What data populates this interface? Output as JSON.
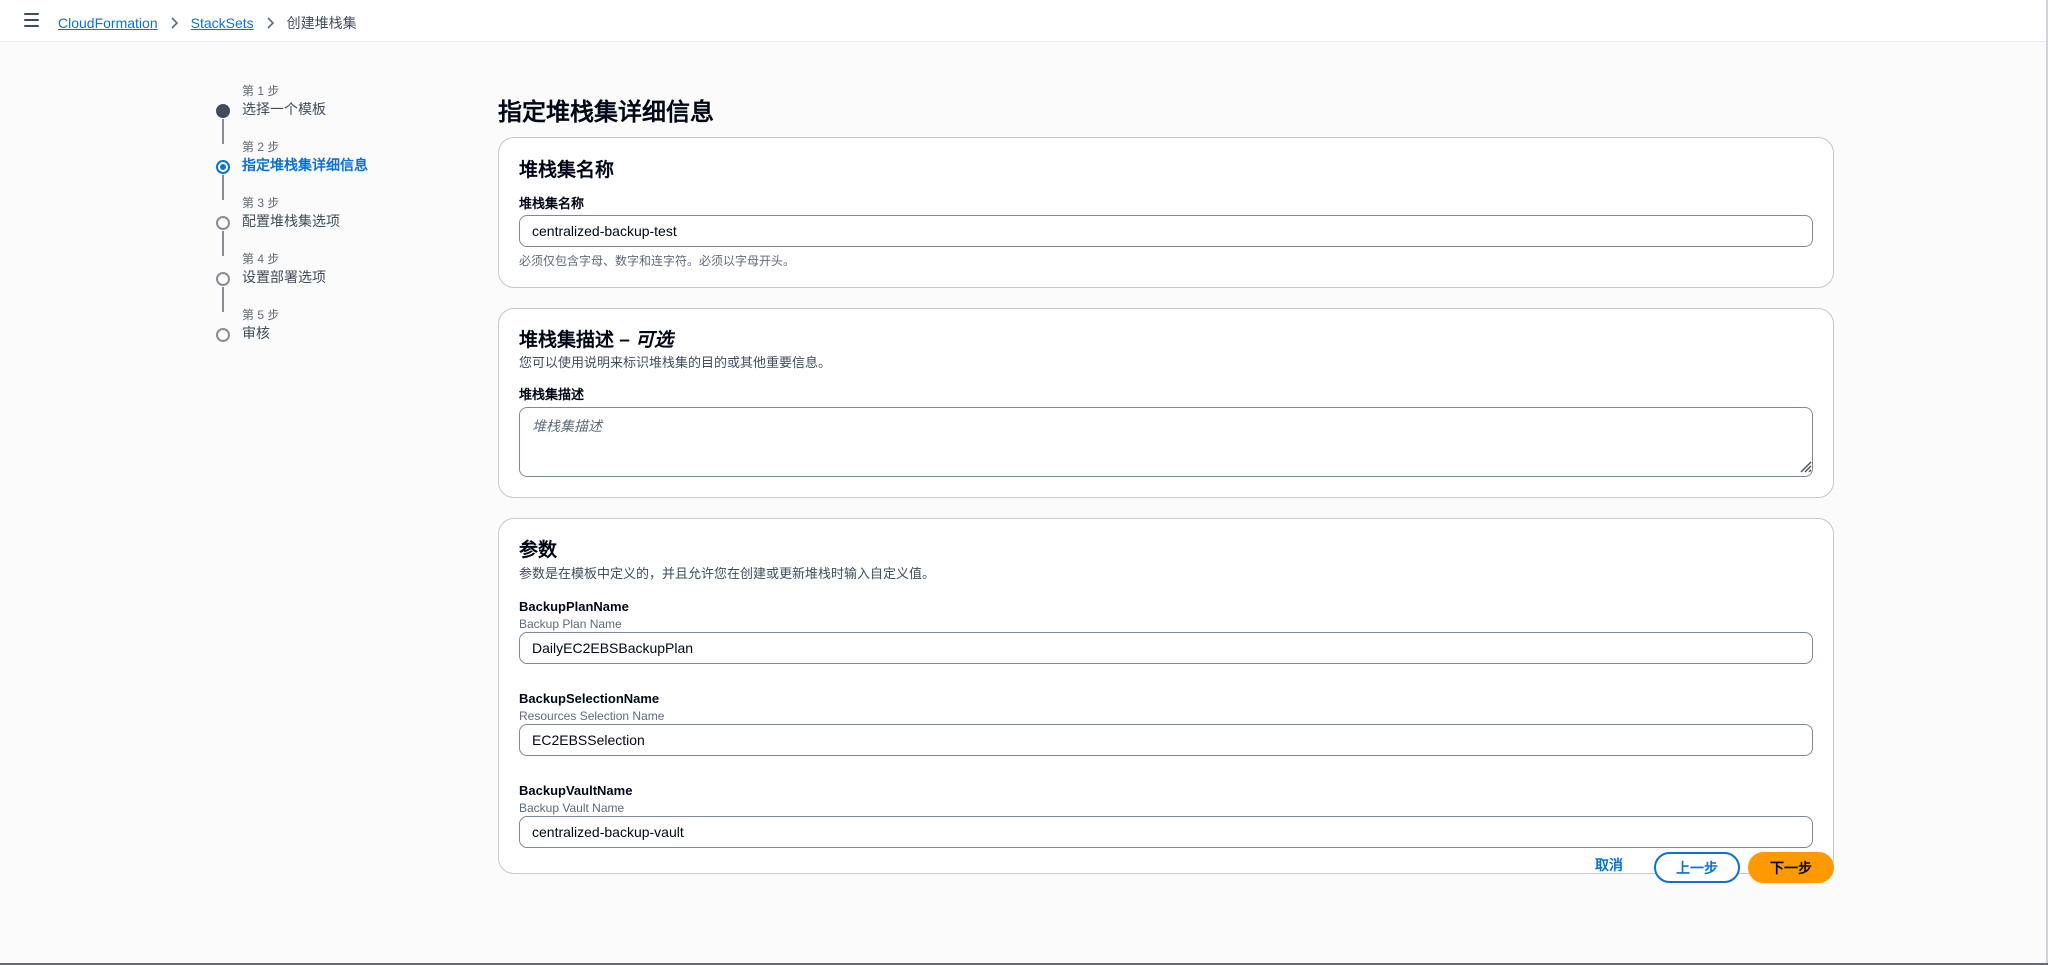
{
  "breadcrumb": {
    "items": [
      "CloudFormation",
      "StackSets"
    ],
    "current": "创建堆栈集"
  },
  "steps": [
    {
      "number": "第 1 步",
      "title": "选择一个模板",
      "state": "done"
    },
    {
      "number": "第 2 步",
      "title": "指定堆栈集详细信息",
      "state": "active"
    },
    {
      "number": "第 3 步",
      "title": "配置堆栈集选项",
      "state": "pending"
    },
    {
      "number": "第 4 步",
      "title": "设置部署选项",
      "state": "pending"
    },
    {
      "number": "第 5 步",
      "title": "审核",
      "state": "pending"
    }
  ],
  "page_title": "指定堆栈集详细信息",
  "name_section": {
    "title": "堆栈集名称",
    "label": "堆栈集名称",
    "value": "centralized-backup-test",
    "constraint": "必须仅包含字母、数字和连字符。必须以字母开头。"
  },
  "description_section": {
    "title": "堆栈集描述 – ",
    "title_optional": "可选",
    "desc": "您可以使用说明来标识堆栈集的目的或其他重要信息。",
    "label": "堆栈集描述",
    "placeholder": "堆栈集描述"
  },
  "parameters_section": {
    "title": "参数",
    "desc": "参数是在模板中定义的，并且允许您在创建或更新堆栈时输入自定义值。",
    "params": [
      {
        "name": "BackupPlanName",
        "description": "Backup Plan Name",
        "value": "DailyEC2EBSBackupPlan"
      },
      {
        "name": "BackupSelectionName",
        "description": "Resources Selection Name",
        "value": "EC2EBSSelection"
      },
      {
        "name": "BackupVaultName",
        "description": "Backup Vault Name",
        "value": "centralized-backup-vault"
      }
    ]
  },
  "actions": {
    "cancel": "取消",
    "previous": "上一步",
    "next": "下一步"
  },
  "colors": {
    "link": "#0972d3",
    "primary_button": "#ff9900",
    "text": "#000716"
  }
}
